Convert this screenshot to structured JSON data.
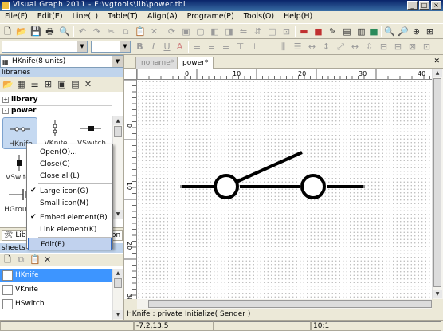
{
  "window": {
    "title": "Visual Graph 2011 - E:\\vgtools\\lib\\power.tbl"
  },
  "menubar": [
    "File(F)",
    "Edit(E)",
    "Line(L)",
    "Table(T)",
    "Align(A)",
    "Programe(P)",
    "Tools(O)",
    "Help(H)"
  ],
  "element_selector": {
    "value": "HKnife(8 units)"
  },
  "libraries": {
    "header": "libraries",
    "tree": [
      {
        "toggle": "+",
        "label": "library"
      },
      {
        "toggle": "-",
        "label": "power"
      }
    ],
    "icons": [
      "HKnife",
      "VKnife",
      "VSwitch",
      "VSwitch",
      "",
      "",
      "HGround",
      "",
      ""
    ],
    "tabs": [
      "Libra",
      "on"
    ]
  },
  "context_menu": {
    "items": [
      {
        "label": "Open(O)...",
        "checked": false
      },
      {
        "label": "Close(C)",
        "checked": false
      },
      {
        "label": "Close all(L)",
        "checked": false
      },
      {
        "label": "Large icon(G)",
        "checked": true
      },
      {
        "label": "Small icon(M)",
        "checked": false
      },
      {
        "label": "Embed element(B)",
        "checked": true
      },
      {
        "label": "Link element(K)",
        "checked": false
      },
      {
        "label": "Edit(E)",
        "checked": false
      }
    ]
  },
  "sheets": {
    "header": "sheets",
    "items": [
      "HKnife",
      "VKnife",
      "HSwitch"
    ],
    "selected": "HKnife"
  },
  "document": {
    "tabs": [
      "noname*",
      "power*"
    ],
    "active_tab": "power*",
    "ruler_top": [
      "0",
      "10",
      "20",
      "30",
      "40"
    ],
    "ruler_left": [
      "0",
      "10",
      "20",
      "30"
    ],
    "status_line": "HKnife : private Initialize( Sender )"
  },
  "statusbar": {
    "coords": "-7.2,13.5",
    "zoom": "10:1"
  },
  "colors": {
    "title_bar": "#0a246a",
    "selection": "#3d95ff",
    "menu_hover": "#c1d2ee"
  }
}
